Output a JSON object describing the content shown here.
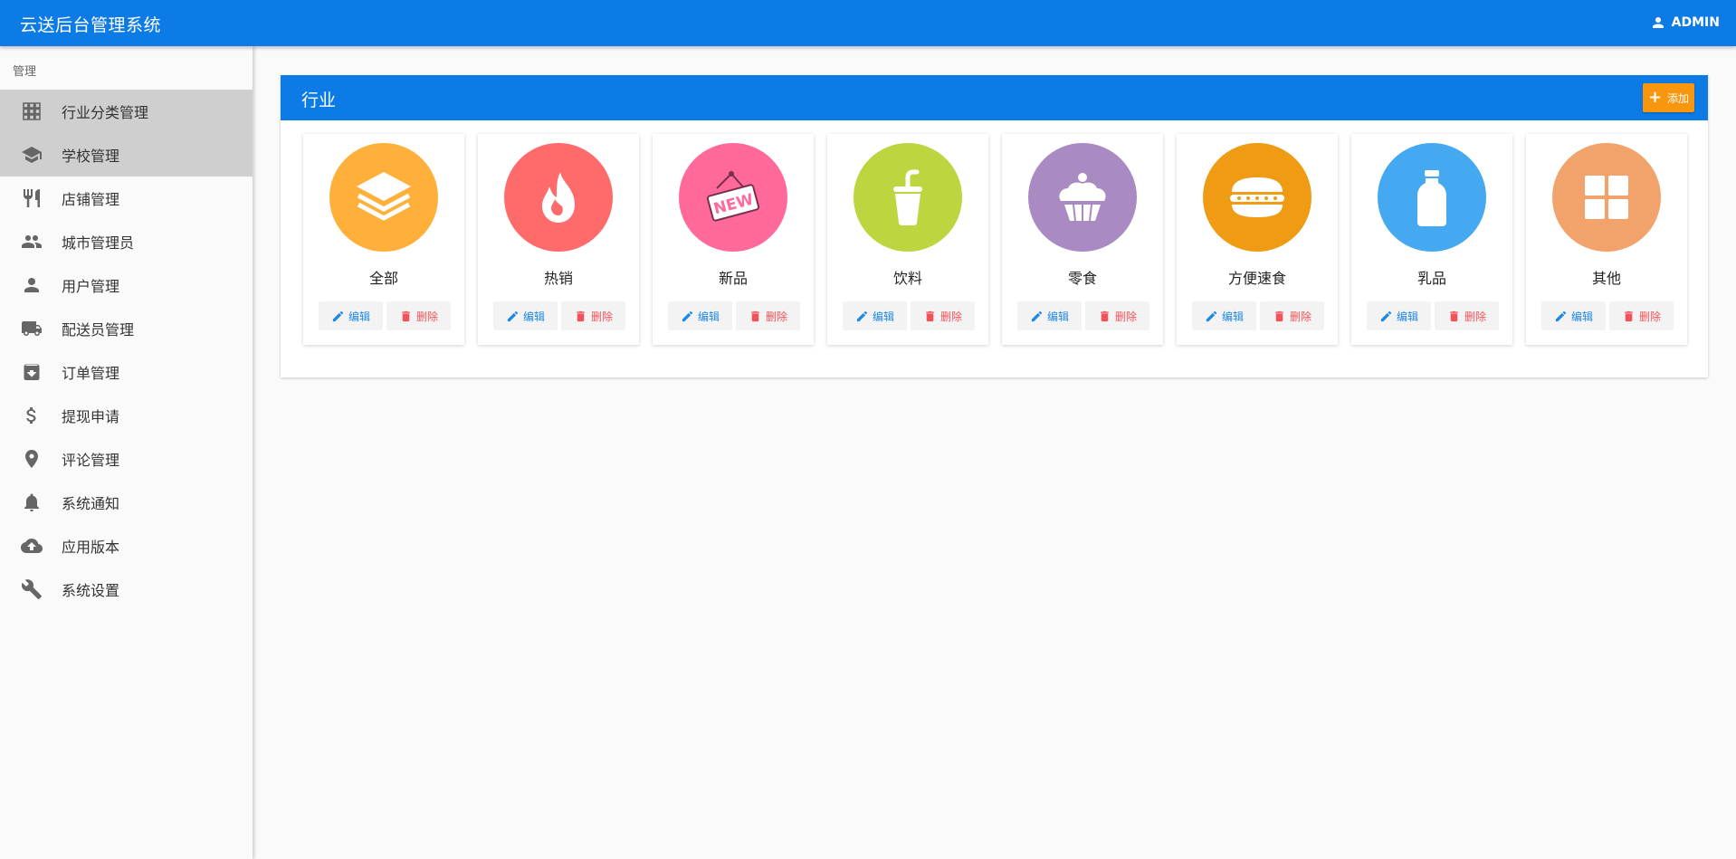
{
  "app": {
    "title": "云送后台管理系统",
    "user": "ADMIN"
  },
  "sidebar": {
    "section_label": "管理",
    "items": [
      {
        "label": "行业分类管理",
        "icon": "grid-icon",
        "active": true
      },
      {
        "label": "学校管理",
        "icon": "school-icon",
        "active": true
      },
      {
        "label": "店铺管理",
        "icon": "restaurant-icon",
        "active": false
      },
      {
        "label": "城市管理员",
        "icon": "people-icon",
        "active": false
      },
      {
        "label": "用户管理",
        "icon": "person-icon",
        "active": false
      },
      {
        "label": "配送员管理",
        "icon": "truck-icon",
        "active": false
      },
      {
        "label": "订单管理",
        "icon": "archive-icon",
        "active": false
      },
      {
        "label": "提现申请",
        "icon": "dollar-icon",
        "active": false
      },
      {
        "label": "评论管理",
        "icon": "location-pin-icon",
        "active": false
      },
      {
        "label": "系统通知",
        "icon": "bell-icon",
        "active": false
      },
      {
        "label": "应用版本",
        "icon": "cloud-upload-icon",
        "active": false
      },
      {
        "label": "系统设置",
        "icon": "wrench-icon",
        "active": false
      }
    ]
  },
  "panel": {
    "title": "行业",
    "add_label": "添加",
    "edit_label": "编辑",
    "delete_label": "删除",
    "categories": [
      {
        "name": "全部",
        "icon": "layers-icon",
        "color": "#ffb03b"
      },
      {
        "name": "热销",
        "icon": "flame-icon",
        "color": "#ff6b6b"
      },
      {
        "name": "新品",
        "icon": "new-sign-icon",
        "color": "#ff6a9b"
      },
      {
        "name": "饮料",
        "icon": "drink-cup-icon",
        "color": "#bdd63f"
      },
      {
        "name": "零食",
        "icon": "cupcake-icon",
        "color": "#a98ac3"
      },
      {
        "name": "方便速食",
        "icon": "burger-icon",
        "color": "#ef9b13"
      },
      {
        "name": "乳品",
        "icon": "milk-bottle-icon",
        "color": "#44a9f1"
      },
      {
        "name": "其他",
        "icon": "four-squares-icon",
        "color": "#f2a36b"
      }
    ]
  }
}
